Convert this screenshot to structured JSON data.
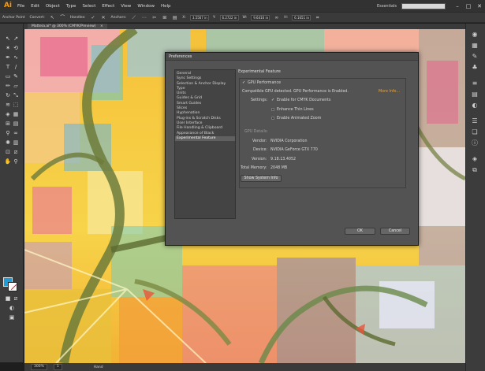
{
  "app": {
    "logo": "Ai",
    "menu": [
      "File",
      "Edit",
      "Object",
      "Type",
      "Select",
      "Effect",
      "View",
      "Window",
      "Help"
    ],
    "workspace": "Essentials",
    "window_controls": [
      "–",
      "□",
      "✕"
    ]
  },
  "controlbar": {
    "tool_label": "Anchor Point",
    "convert_label": "Convert:",
    "handles_label": "Handles:",
    "anchors_label": "Anchors:",
    "x_label": "X:",
    "x_value": "3.5567 in",
    "y_label": "Y:",
    "y_value": "6.2722 in",
    "w_label": "W:",
    "w_value": "9.6416 in",
    "h_label": "H:",
    "h_value": "6.1651 in"
  },
  "document": {
    "tab_title": "Matteia.ai* @ 300% (CMYK/Preview)",
    "close": "×"
  },
  "statusbar": {
    "zoom": "300%",
    "page": "1",
    "tool": "Hand"
  },
  "preferences": {
    "title": "Preferences",
    "categories": [
      "General",
      "Sync Settings",
      "Selection & Anchor Display",
      "Type",
      "Units",
      "Guides & Grid",
      "Smart Guides",
      "Slices",
      "Hyphenation",
      "Plug-ins & Scratch Disks",
      "User Interface",
      "File Handling & Clipboard",
      "Appearance of Black",
      "Experimental Feature"
    ],
    "selected_category": "Experimental Feature",
    "section_title": "Experimental Feature",
    "gpu_checkbox_label": "GPU Performance",
    "gpu_detected": "Compatible GPU detected. GPU Performance is Enabled.",
    "more_info": "More Info...",
    "settings_label": "Settings:",
    "enable_cmyk": "Enable for CMYK Documents",
    "enhance_thin": "Enhance Thin Lines",
    "enable_zoom": "Enable Animated Zoom",
    "gpu_details_label": "GPU Details:",
    "vendor_label": "Vendor:",
    "vendor_value": "NVIDIA Corporation",
    "device_label": "Device:",
    "device_value": "NVIDIA GeForce GTX 770",
    "version_label": "Version:",
    "version_value": "9.18.13.4052",
    "memory_label": "Total Memory:",
    "memory_value": "2048 MB",
    "show_system_info": "Show System Info",
    "ok": "OK",
    "cancel": "Cancel",
    "gpu_enabled": true,
    "cmyk_enabled": true,
    "thin_lines_enabled": false,
    "animated_zoom_enabled": false
  },
  "colors": {
    "accent_link": "#e8a53a",
    "fill": "#1f9bd7",
    "stroke": "#ffffff"
  }
}
